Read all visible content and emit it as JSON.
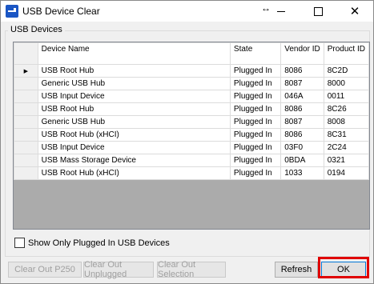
{
  "window": {
    "title": "USB Device Clear",
    "close_glyph": "✕",
    "cursor_glyph": "↔"
  },
  "group": {
    "label": "USB Devices"
  },
  "table": {
    "columns": [
      "Device Name",
      "State",
      "Vendor ID",
      "Product ID"
    ],
    "selected_row_marker": "▶",
    "rows": [
      [
        "USB Root Hub",
        "Plugged In",
        "8086",
        "8C2D"
      ],
      [
        "Generic USB Hub",
        "Plugged In",
        "8087",
        "8000"
      ],
      [
        "USB Input Device",
        "Plugged In",
        "046A",
        "0011"
      ],
      [
        "USB Root Hub",
        "Plugged In",
        "8086",
        "8C26"
      ],
      [
        "Generic USB Hub",
        "Plugged In",
        "8087",
        "8008"
      ],
      [
        "USB Root Hub (xHCI)",
        "Plugged In",
        "8086",
        "8C31"
      ],
      [
        "USB Input Device",
        "Plugged In",
        "03F0",
        "2C24"
      ],
      [
        "USB Mass Storage Device",
        "Plugged In",
        "0BDA",
        "0321"
      ],
      [
        "USB Root Hub (xHCI)",
        "Plugged In",
        "1033",
        "0194"
      ]
    ]
  },
  "filter": {
    "label": "Show Only Plugged In USB Devices",
    "checked": false
  },
  "buttons": {
    "clear_p250": "Clear Out P250",
    "clear_unplugged": "Clear Out Unplugged",
    "clear_selection": "Clear Out Selection",
    "refresh": "Refresh",
    "ok": "OK"
  },
  "colors": {
    "highlight": "#e00000",
    "accent": "#1a56c4"
  }
}
